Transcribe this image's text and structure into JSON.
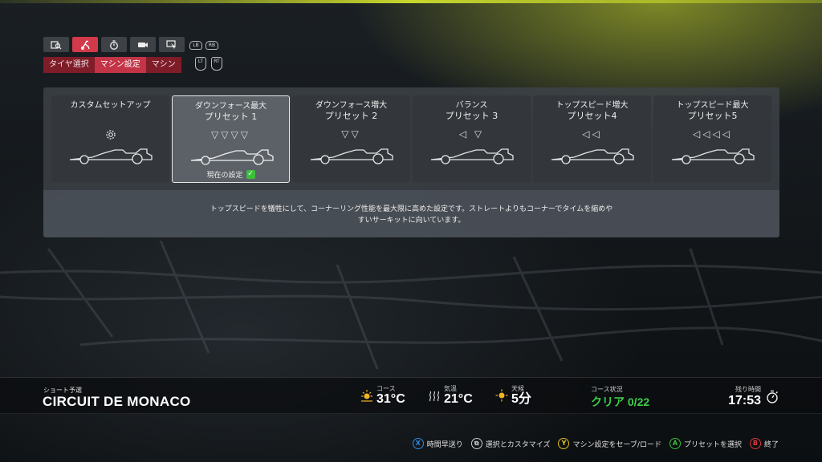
{
  "top_tabs": {
    "icons": [
      "telemetry-icon",
      "car-setup-icon",
      "timing-icon",
      "camera-icon",
      "settings-icon"
    ],
    "active_index": 1,
    "bumper_left": "LB",
    "bumper_right": "RB"
  },
  "sub_tabs": {
    "items": [
      "タイヤ選択",
      "マシン設定",
      "マシン"
    ],
    "active_index": 1,
    "trigger_left": "LT",
    "trigger_right": "RT"
  },
  "presets": [
    {
      "title": "カスタムセットアップ",
      "subtitle": "",
      "arrows": "",
      "icon": "gear-icon"
    },
    {
      "title": "ダウンフォース最大",
      "subtitle": "プリセット 1",
      "arrows": "▽▽▽▽"
    },
    {
      "title": "ダウンフォース増大",
      "subtitle": "プリセット 2",
      "arrows": "▽▽"
    },
    {
      "title": "バランス",
      "subtitle": "プリセット 3",
      "arrows": "◁ ▽"
    },
    {
      "title": "トップスピード増大",
      "subtitle": "プリセット4",
      "arrows": "◁◁"
    },
    {
      "title": "トップスピード最大",
      "subtitle": "プリセット5",
      "arrows": "◁◁◁◁"
    }
  ],
  "selected_preset": 1,
  "current_setting_label": "現在の設定",
  "description": {
    "line1": "トップスピードを犠牲にして、コーナーリング性能を最大限に高めた設定です。ストレートよりもコーナーでタイムを縮めや",
    "line2": "すいサーキットに向いています。"
  },
  "info_bar": {
    "session": "ショート予選",
    "circuit": "CIRCUIT DE MONACO",
    "course_temp_label": "コース",
    "course_temp": "31°C",
    "air_temp_label": "気温",
    "air_temp": "21°C",
    "weather_label": "天候",
    "weather": "5分",
    "track_status_label": "コース状況",
    "track_status": "クリア 0/22",
    "remaining_label": "残り時間",
    "remaining": "17:53"
  },
  "hints": {
    "x_button": "X",
    "x_label": "時間早送り",
    "view_label": "選択とカスタマイズ",
    "y_button": "Y",
    "y_label": "マシン設定をセーブ/ロード",
    "a_button": "A",
    "a_label": "プリセットを選択",
    "b_button": "B",
    "b_label": "終了"
  },
  "colors": {
    "accent_red": "#c23446",
    "status_green": "#3ccf4a",
    "highlight_yellow": "#c8d82c"
  }
}
